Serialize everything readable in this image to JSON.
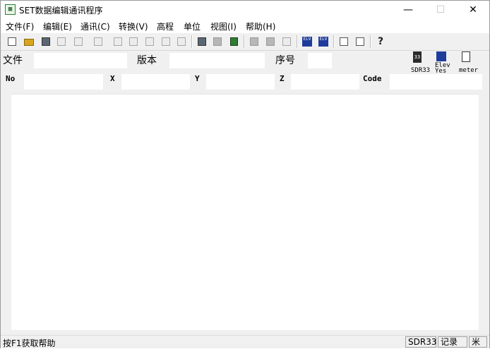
{
  "window": {
    "title": "SET数据编辑通讯程序",
    "min_glyph": "—",
    "max_glyph": "☐",
    "close_glyph": "✕"
  },
  "menu": {
    "file": "文件(F)",
    "edit": "编辑(E)",
    "comm": "通讯(C)",
    "convert": "转换(V)",
    "elevation": "高程",
    "unit": "单位",
    "view": "视图(I)",
    "help": "帮助(H)"
  },
  "toolbar": {
    "icons": [
      "new-file-icon",
      "open-folder-icon",
      "save-disk-icon",
      "save-as-icon",
      "print-icon",
      "print-preview-icon",
      "cut-icon",
      "copy-icon",
      "paste-icon",
      "export-icon",
      "import-icon",
      "books-icon",
      "record-1-icon",
      "record-2-icon",
      "record-3-icon",
      "elevation-n-icon",
      "elevation-y-icon",
      "calculator-icon",
      "calculator-2-icon",
      "about-icon"
    ],
    "elev_n_text": "ELV",
    "elev_y_text": "ELV",
    "help_glyph": "?"
  },
  "fields": {
    "file_label": "文件",
    "version_label": "版本",
    "seq_label": "序号",
    "file_value": "",
    "version_value": "",
    "seq_value": ""
  },
  "record": {
    "no_label": "No",
    "x_label": "X",
    "y_label": "Y",
    "z_label": "Z",
    "code_label": "Code",
    "no_value": "",
    "x_value": "",
    "y_value": "",
    "z_value": "",
    "code_value": ""
  },
  "panel": {
    "device_label": "SDR33",
    "elev_line1": "Elev",
    "elev_line2": "Yes",
    "unit_label": "meter",
    "device_icon_text": "33"
  },
  "status": {
    "hint": "按F1获取帮助",
    "device": "SDR33",
    "record_word": "记录",
    "unit": "米"
  },
  "colors": {
    "accent_blue": "#1e3c9b",
    "folder_gold": "#d9a520",
    "book_green": "#2e7d32"
  }
}
